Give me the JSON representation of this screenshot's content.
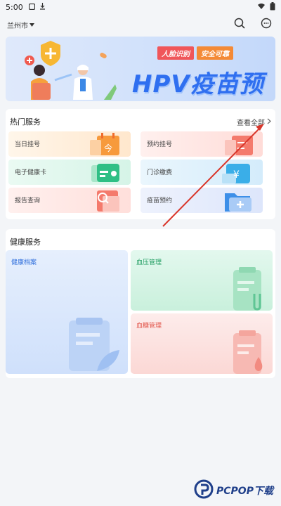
{
  "status_bar": {
    "time": "5:00"
  },
  "header": {
    "city": "兰州市"
  },
  "banner": {
    "tag1": "人脸识别",
    "tag2": "安全可靠",
    "headline": "HPV疫苗预约"
  },
  "hot_services": {
    "title": "热门服务",
    "see_all": "查看全部",
    "items": [
      {
        "label": "当日挂号"
      },
      {
        "label": "预约挂号"
      },
      {
        "label": "电子健康卡"
      },
      {
        "label": "门诊缴费"
      },
      {
        "label": "报告查询"
      },
      {
        "label": "疫苗预约"
      }
    ]
  },
  "health_services": {
    "title": "健康服务",
    "items": [
      {
        "label": "健康档案"
      },
      {
        "label": "血压管理"
      },
      {
        "label": "血糖管理"
      }
    ]
  },
  "watermark": {
    "text": "PCPOP下载"
  }
}
